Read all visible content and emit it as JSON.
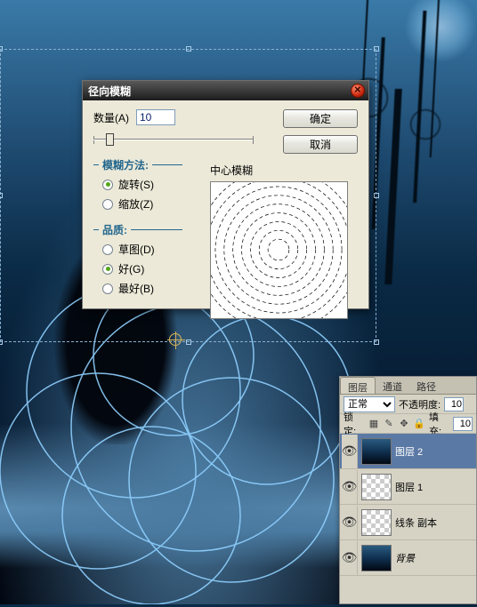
{
  "dialog": {
    "title": "径向模糊",
    "amount_label": "数量(A)",
    "amount_value": "10",
    "ok_label": "确定",
    "cancel_label": "取消",
    "method_group": "模糊方法:",
    "method_options": [
      {
        "label": "旋转(S)",
        "checked": true
      },
      {
        "label": "缩放(Z)",
        "checked": false
      }
    ],
    "quality_group": "品质:",
    "quality_options": [
      {
        "label": "草图(D)",
        "checked": false
      },
      {
        "label": "好(G)",
        "checked": true
      },
      {
        "label": "最好(B)",
        "checked": false
      }
    ],
    "preview_label": "中心模糊"
  },
  "layers_panel": {
    "tabs": {
      "layers": "图层",
      "channels": "通道",
      "paths": "路径"
    },
    "blend_mode": "正常",
    "opacity_label": "不透明度:",
    "opacity_value": "10",
    "lock_label": "锁定:",
    "fill_label": "填充:",
    "fill_value": "10",
    "layers": [
      {
        "name": "图层 2",
        "thumb": "img",
        "active": true
      },
      {
        "name": "图层 1",
        "thumb": "checker",
        "active": false
      },
      {
        "name": "线条 副本",
        "thumb": "checker",
        "active": false
      },
      {
        "name": "背景",
        "thumb": "img",
        "active": false,
        "italic": true
      }
    ]
  }
}
